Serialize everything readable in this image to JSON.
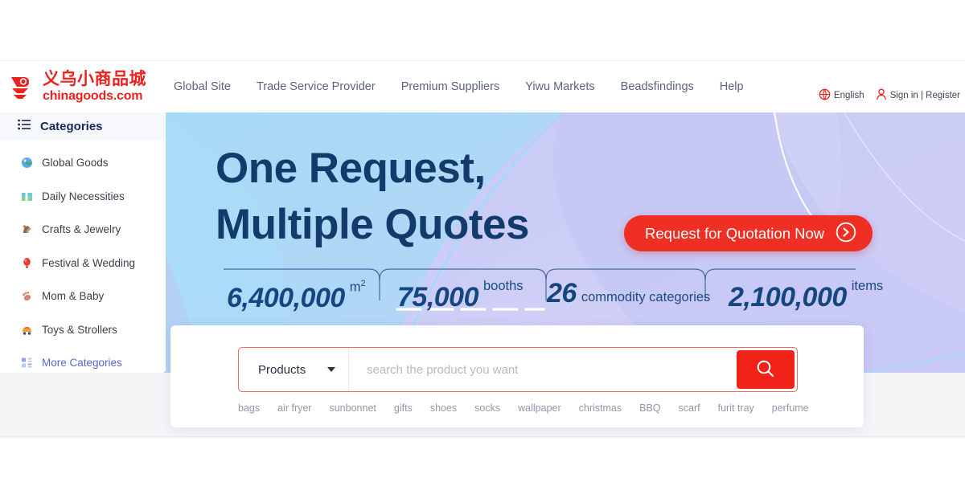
{
  "brand": {
    "logo_cn": "义乌小商品城",
    "logo_en": "chinagoods.com",
    "logo_icon": "chinagoods-logo-mark",
    "red": "#e8231f"
  },
  "header": {
    "nav": [
      {
        "label": "Global Site"
      },
      {
        "label": "Trade Service Provider"
      },
      {
        "label": "Premium Suppliers"
      },
      {
        "label": "Yiwu Markets"
      },
      {
        "label": "Beadsfindings"
      },
      {
        "label": "Help"
      }
    ],
    "language": {
      "label": "English",
      "icon": "globe-icon"
    },
    "account": {
      "label": "Sign in | Register",
      "icon": "user-icon"
    }
  },
  "sidebar": {
    "title": "Categories",
    "title_icon": "list-icon",
    "items": [
      {
        "label": "Global Goods",
        "icon": "globe-goods-icon"
      },
      {
        "label": "Daily Necessities",
        "icon": "box-icon"
      },
      {
        "label": "Crafts & Jewelry",
        "icon": "crafts-icon"
      },
      {
        "label": "Festival & Wedding",
        "icon": "balloon-icon"
      },
      {
        "label": "Mom & Baby",
        "icon": "baby-icon"
      },
      {
        "label": "Toys & Strollers",
        "icon": "toy-icon"
      },
      {
        "label": "More Categories",
        "icon": "grid-icon"
      }
    ]
  },
  "hero": {
    "headline_line1": "One Request,",
    "headline_line2": "Multiple Quotes",
    "cta": {
      "label": "Request for Quotation Now",
      "icon": "arrow-circle-right-icon",
      "color": "#ef2e24"
    },
    "stats": [
      {
        "value": "6,400,000",
        "unit": "m",
        "unit_sup": "2"
      },
      {
        "value": "75,000",
        "unit": "booths",
        "unit_sup": ""
      },
      {
        "value": "26",
        "unit": "commodity categories",
        "unit_sup": ""
      },
      {
        "value": "2,100,000",
        "unit": "items",
        "unit_sup": ""
      }
    ]
  },
  "search": {
    "category_label": "Products",
    "placeholder": "search the product you want",
    "value": "",
    "button_icon": "search-icon",
    "button_color": "#ef2118",
    "hot_words": [
      "bags",
      "air fryer",
      "sunbonnet",
      "gifts",
      "shoes",
      "socks",
      "wallpaper",
      "christmas",
      "BBQ",
      "scarf",
      "furit tray",
      "perfume"
    ]
  }
}
